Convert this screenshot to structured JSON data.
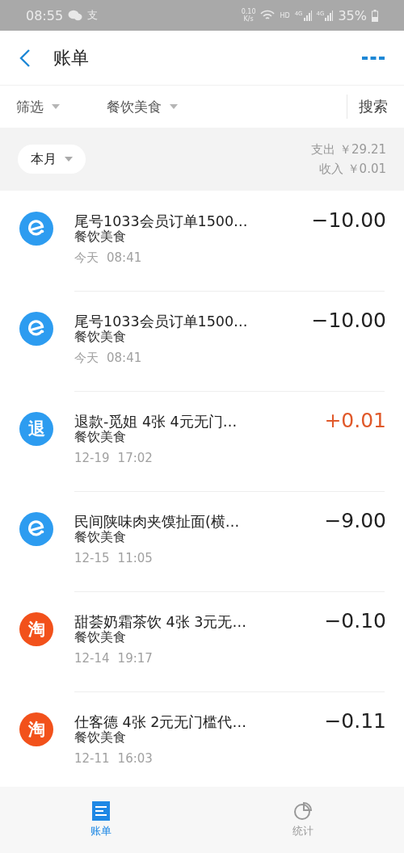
{
  "status_bar": {
    "time": "08:55",
    "app_badge": "支",
    "speed": "0.10",
    "speed_unit": "K/s",
    "hd": "HD",
    "networks": [
      "4G",
      "4G"
    ],
    "battery": "35%"
  },
  "header": {
    "title": "账单"
  },
  "filters": [
    {
      "label": "筛选"
    },
    {
      "label": "餐饮美食"
    }
  ],
  "search": "搜索",
  "summary": {
    "period": "本月",
    "expense": "支出 ￥29.21",
    "income": "收入 ￥0.01"
  },
  "transactions": [
    {
      "icon": {
        "kind": "e",
        "color": "#2d9cf0"
      },
      "title": "尾号1033会员订单1500…",
      "category": "餐饮美食",
      "date": "今天",
      "time": "08:41",
      "amount": "−10.00",
      "income": false
    },
    {
      "icon": {
        "kind": "e",
        "color": "#2d9cf0"
      },
      "title": "尾号1033会员订单1500…",
      "category": "餐饮美食",
      "date": "今天",
      "time": "08:41",
      "amount": "−10.00",
      "income": false
    },
    {
      "icon": {
        "kind": "char",
        "char": "退",
        "color": "#2d9cf0"
      },
      "title": "退款-觅姐 4张 4元无门…",
      "category": "餐饮美食",
      "date": "12-19",
      "time": "17:02",
      "amount": "+0.01",
      "income": true
    },
    {
      "icon": {
        "kind": "e",
        "color": "#2d9cf0"
      },
      "title": "民间陕味肉夹馍扯面(横…",
      "category": "餐饮美食",
      "date": "12-15",
      "time": "11:05",
      "amount": "−9.00",
      "income": false
    },
    {
      "icon": {
        "kind": "char",
        "char": "淘",
        "color": "#f2511b"
      },
      "title": "甜荟奶霜茶饮 4张 3元无…",
      "category": "餐饮美食",
      "date": "12-14",
      "time": "19:17",
      "amount": "−0.10",
      "income": false
    },
    {
      "icon": {
        "kind": "char",
        "char": "淘",
        "color": "#f2511b"
      },
      "title": "仕客德 4张 2元无门槛代…",
      "category": "餐饮美食",
      "date": "12-11",
      "time": "16:03",
      "amount": "−0.11",
      "income": false
    }
  ],
  "tab_bar": [
    {
      "label": "账单",
      "kind": "list",
      "selected": true
    },
    {
      "label": "统计",
      "kind": "chart",
      "selected": false
    }
  ]
}
